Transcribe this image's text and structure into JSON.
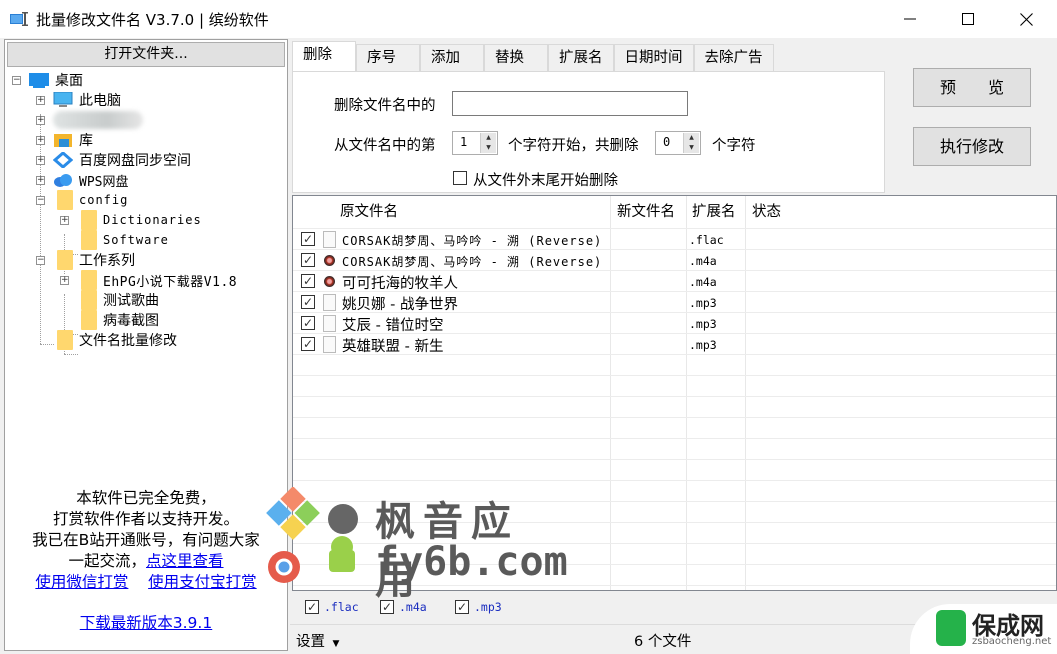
{
  "window": {
    "title": "批量修改文件名 V3.7.0 | 缤纷软件",
    "minimize_glyph": "—",
    "maximize_glyph": "☐",
    "close_glyph": "✕"
  },
  "left_panel": {
    "open_folder_label": "打开文件夹...",
    "tree": [
      {
        "label": "桌面",
        "icon": "desktop-icon",
        "expander": "minus"
      },
      {
        "label": "此电脑",
        "icon": "computer-icon",
        "expander": "plus"
      },
      {
        "label": "",
        "icon": "user-icon",
        "expander": "plus",
        "blurred": true
      },
      {
        "label": "库",
        "icon": "library-icon",
        "expander": "plus"
      },
      {
        "label": "百度网盘同步空间",
        "icon": "baidu-netdisk-icon",
        "expander": "plus"
      },
      {
        "label": "WPS网盘",
        "icon": "wps-cloud-icon",
        "expander": "plus"
      },
      {
        "label": "config",
        "icon": "folder-icon",
        "expander": "minus"
      },
      {
        "label": "Dictionaries",
        "icon": "folder-icon",
        "expander": "plus"
      },
      {
        "label": "Software",
        "icon": "folder-icon",
        "expander": ""
      },
      {
        "label": "工作系列",
        "icon": "folder-icon",
        "expander": "minus"
      },
      {
        "label": "EhPG小说下载器V1.8",
        "icon": "folder-icon",
        "expander": "plus"
      },
      {
        "label": "测试歌曲",
        "icon": "folder-icon",
        "expander": ""
      },
      {
        "label": "病毒截图",
        "icon": "folder-icon",
        "expander": ""
      },
      {
        "label": "文件名批量修改",
        "icon": "folder-icon",
        "expander": ""
      }
    ],
    "promo": {
      "line1": "本软件已完全免费，",
      "line2": "打赏软件作者以支持开发。",
      "line3": "我已在B站开通账号，有问题大家",
      "line4_prefix": "一起交流，",
      "line4_link": "点这里查看",
      "wechat_link": "使用微信打赏",
      "alipay_link": "使用支付宝打赏",
      "download_link": "下载最新版本3.9.1"
    }
  },
  "tabs": [
    {
      "label": "删除",
      "active": true
    },
    {
      "label": "序号"
    },
    {
      "label": "添加"
    },
    {
      "label": "替换"
    },
    {
      "label": "扩展名"
    },
    {
      "label": "日期时间"
    },
    {
      "label": "去除广告"
    }
  ],
  "delete_panel": {
    "delete_text_label": "删除文件名中的",
    "delete_text_value": "",
    "from_label": "从文件名中的第",
    "start_value": "1",
    "middle_label": "个字符开始，共删除",
    "count_value": "0",
    "suffix_label": "个字符",
    "from_end_label": "从文件外末尾开始删除",
    "from_end_checked": false
  },
  "actions": {
    "preview_label": "预　　览",
    "execute_label": "执行修改"
  },
  "file_list": {
    "columns": [
      "原文件名",
      "新文件名",
      "扩展名",
      "状态"
    ],
    "rows": [
      {
        "checked": true,
        "name": "CORSAK胡梦周、马吟吟 - 溯 (Reverse)",
        "new_name": "",
        "ext": ".flac",
        "status": "",
        "icon": "file-icon"
      },
      {
        "checked": true,
        "name": "CORSAK胡梦周、马吟吟 - 溯 (Reverse)",
        "new_name": "",
        "ext": ".m4a",
        "status": "",
        "icon": "media-file-icon"
      },
      {
        "checked": true,
        "name": "可可托海的牧羊人",
        "new_name": "",
        "ext": ".m4a",
        "status": "",
        "icon": "media-file-icon"
      },
      {
        "checked": true,
        "name": "姚贝娜 - 战争世界",
        "new_name": "",
        "ext": ".mp3",
        "status": "",
        "icon": "file-icon"
      },
      {
        "checked": true,
        "name": "艾辰 - 错位时空",
        "new_name": "",
        "ext": ".mp3",
        "status": "",
        "icon": "file-icon"
      },
      {
        "checked": true,
        "name": "英雄联盟 - 新生",
        "new_name": "",
        "ext": ".mp3",
        "status": "",
        "icon": "file-icon"
      }
    ]
  },
  "ext_filters": [
    {
      "label": ".flac",
      "checked": true
    },
    {
      "label": ".m4a",
      "checked": true
    },
    {
      "label": ".mp3",
      "checked": true
    }
  ],
  "statusbar": {
    "settings_label": "设置",
    "file_count": "6 个文件"
  },
  "watermarks": {
    "fy6b_title": "枫音应用",
    "fy6b_url": "fy6b.com",
    "baocheng_name": "保成网",
    "baocheng_url": "zsbaocheng.net"
  },
  "colors": {
    "link": "#0000ee",
    "ext_filter_text": "#1a2dbf",
    "folder": "#ffd76e",
    "window_bg": "#f0f0f0"
  }
}
